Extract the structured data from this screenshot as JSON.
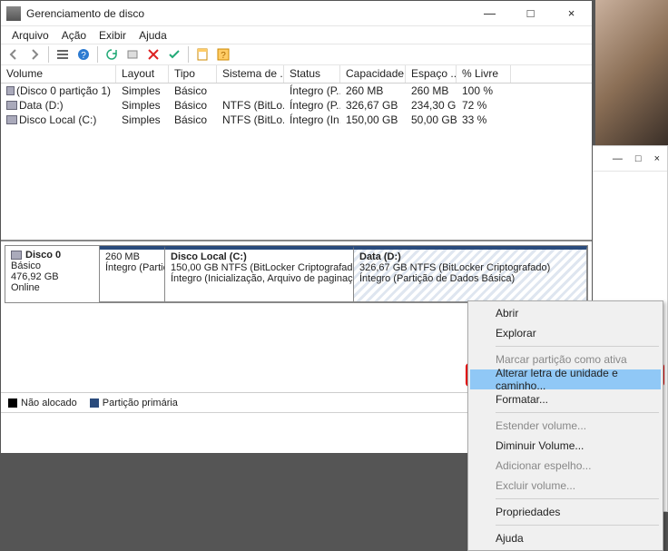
{
  "window": {
    "title": "Gerenciamento de disco",
    "menus": [
      "Arquivo",
      "Ação",
      "Exibir",
      "Ajuda"
    ]
  },
  "columns": {
    "volume": "Volume",
    "layout": "Layout",
    "tipo": "Tipo",
    "sistema": "Sistema de ...",
    "status": "Status",
    "capacidade": "Capacidade",
    "espaco": "Espaço ...",
    "livre": "% Livre"
  },
  "rows": [
    {
      "vol": "(Disco 0 partição 1)",
      "lay": "Simples",
      "typ": "Básico",
      "sys": "",
      "sta": "Íntegro (P...",
      "cap": "260 MB",
      "esp": "260 MB",
      "liv": "100 %"
    },
    {
      "vol": "Data (D:)",
      "lay": "Simples",
      "typ": "Básico",
      "sys": "NTFS (BitLo...",
      "sta": "Íntegro (P...",
      "cap": "326,67 GB",
      "esp": "234,30 GB",
      "liv": "72 %"
    },
    {
      "vol": "Disco Local (C:)",
      "lay": "Simples",
      "typ": "Básico",
      "sys": "NTFS (BitLo...",
      "sta": "Íntegro (In...",
      "cap": "150,00 GB",
      "esp": "50,00 GB",
      "liv": "33 %"
    }
  ],
  "disk": {
    "header": "Disco 0",
    "type": "Básico",
    "size": "476,92 GB",
    "state": "Online",
    "parts": [
      {
        "title": "",
        "l1": "260 MB",
        "l2": "Íntegro (Partição de"
      },
      {
        "title": "Disco Local  (C:)",
        "l1": "150,00 GB NTFS (BitLocker Criptografado)",
        "l2": "Íntegro (Inicialização, Arquivo de paginação,"
      },
      {
        "title": "Data  (D:)",
        "l1": "326,67 GB NTFS (BitLocker Criptografado)",
        "l2": "Íntegro (Partição de Dados Básica)"
      }
    ]
  },
  "legend": {
    "a": "Não alocado",
    "b": "Partição primária"
  },
  "context": {
    "abrir": "Abrir",
    "explorar": "Explorar",
    "marcar": "Marcar partição como ativa",
    "alterar": "Alterar letra de unidade e caminho...",
    "formatar": "Formatar...",
    "estender": "Estender volume...",
    "diminuir": "Diminuir Volume...",
    "espelho": "Adicionar espelho...",
    "excluir": "Excluir volume...",
    "prop": "Propriedades",
    "ajuda": "Ajuda"
  },
  "otherwin": {
    "min": "—",
    "max": "□",
    "close": "×"
  }
}
